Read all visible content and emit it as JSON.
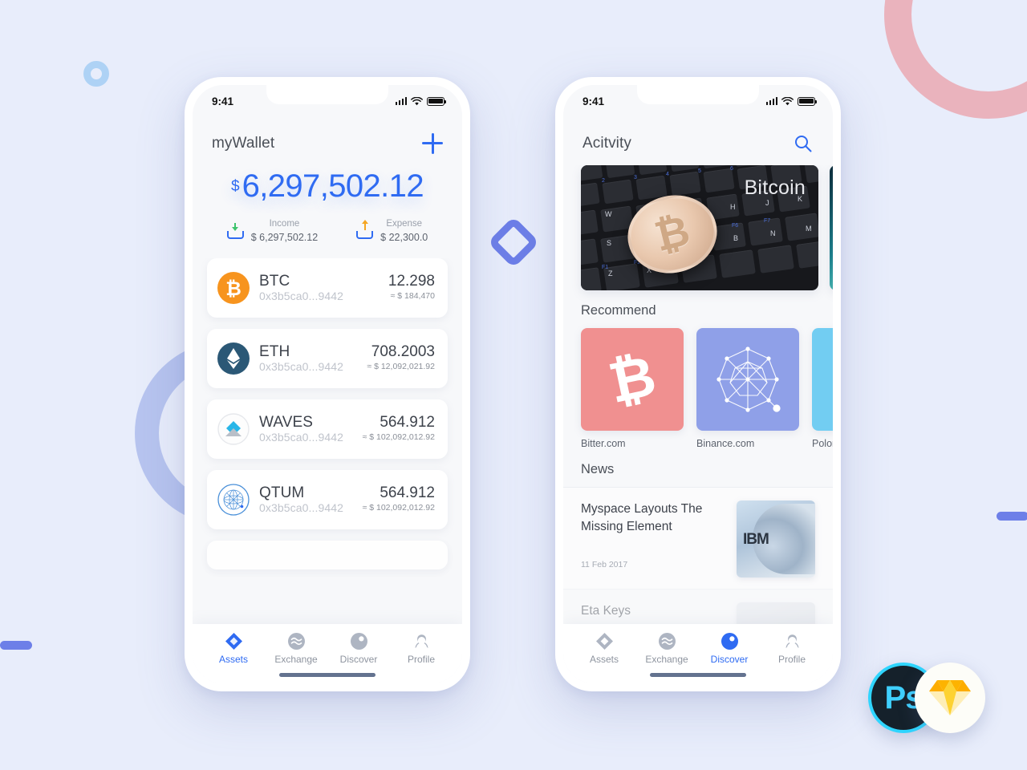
{
  "background": {
    "color": "#e8edfb",
    "shapes": [
      {
        "name": "pink-ring",
        "color": "#eaa8b2"
      },
      {
        "name": "blue-ring",
        "color": "#b7c4ef"
      },
      {
        "name": "small-circle",
        "color": "#aed2f5"
      },
      {
        "name": "diamond-outline",
        "color": "#6d7fe8"
      },
      {
        "name": "left-bar",
        "color": "#6d7fe8"
      },
      {
        "name": "right-bar",
        "color": "#6d7fe8"
      }
    ]
  },
  "accent": "#2f6bf2",
  "phone_wallet": {
    "status": {
      "time": "9:41",
      "signal_icon": "signal-icon",
      "wifi_icon": "wifi-icon",
      "battery_icon": "battery-icon"
    },
    "header": {
      "title": "myWallet",
      "add_icon": "plus-icon"
    },
    "balance": {
      "currency": "$",
      "amount": "6,297,502.12"
    },
    "summary": [
      {
        "label": "Income",
        "value": "$ 6,297,502.12",
        "icon": "income-tray-icon",
        "arrow_color": "#3ec46d"
      },
      {
        "label": "Expense",
        "value": "$ 22,300.0",
        "icon": "expense-tray-icon",
        "arrow_color": "#f5a623"
      }
    ],
    "assets": [
      {
        "symbol": "BTC",
        "address": "0x3b5ca0...9442",
        "amount": "12.298",
        "usd": "≈ $ 184,470",
        "icon": "btc-coin-icon",
        "color": "#f7941e"
      },
      {
        "symbol": "ETH",
        "address": "0x3b5ca0...9442",
        "amount": "708.2003",
        "usd": "≈ $ 12,092,021.92",
        "icon": "eth-coin-icon",
        "color": "#2b5876"
      },
      {
        "symbol": "WAVES",
        "address": "0x3b5ca0...9442",
        "amount": "564.912",
        "usd": "≈ $ 102,092,012.92",
        "icon": "waves-coin-icon",
        "color": "#28b6e8"
      },
      {
        "symbol": "QTUM",
        "address": "0x3b5ca0...9442",
        "amount": "564.912",
        "usd": "≈ $ 102,092,012.92",
        "icon": "qtum-coin-icon",
        "color": "#4a90d9"
      }
    ],
    "tabs": [
      {
        "label": "Assets",
        "icon": "assets-diamond-icon",
        "active": true
      },
      {
        "label": "Exchange",
        "icon": "exchange-waves-icon",
        "active": false
      },
      {
        "label": "Discover",
        "icon": "discover-compass-icon",
        "active": false
      },
      {
        "label": "Profile",
        "icon": "profile-person-icon",
        "active": false
      }
    ]
  },
  "phone_discover": {
    "status": {
      "time": "9:41",
      "signal_icon": "signal-icon",
      "wifi_icon": "wifi-icon",
      "battery_icon": "battery-icon"
    },
    "header": {
      "title": "Acitvity",
      "search_icon": "search-icon"
    },
    "banner": {
      "label": "Bitcoin",
      "image": "bitcoin-coin-on-keyboard"
    },
    "recommend": {
      "section_title": "Recommend",
      "items": [
        {
          "name": "Bitter.com",
          "color": "#f09090",
          "icon": "bitcoin-b-icon"
        },
        {
          "name": "Binance.com",
          "color": "#8fa0e8",
          "icon": "binance-network-icon"
        },
        {
          "name": "Polonie",
          "color": "#72cdf2",
          "icon": "poloniex-icon"
        }
      ]
    },
    "news": {
      "section_title": "News",
      "items": [
        {
          "title": "Myspace Layouts The Missing Element",
          "date": "11 Feb 2017",
          "thumb": "ibm-server-thumb"
        },
        {
          "title": "Eta Keys",
          "date": "",
          "thumb": "person-avatar-thumb"
        }
      ]
    },
    "tabs": [
      {
        "label": "Assets",
        "icon": "assets-diamond-icon",
        "active": false
      },
      {
        "label": "Exchange",
        "icon": "exchange-waves-icon",
        "active": false
      },
      {
        "label": "Discover",
        "icon": "discover-compass-icon",
        "active": true
      },
      {
        "label": "Profile",
        "icon": "profile-person-icon",
        "active": false
      }
    ]
  },
  "badges": [
    {
      "name": "photoshop-badge",
      "label": "Ps",
      "color": "#3fd0ff"
    },
    {
      "name": "sketch-badge",
      "label": "",
      "color": "#f7b500"
    }
  ]
}
